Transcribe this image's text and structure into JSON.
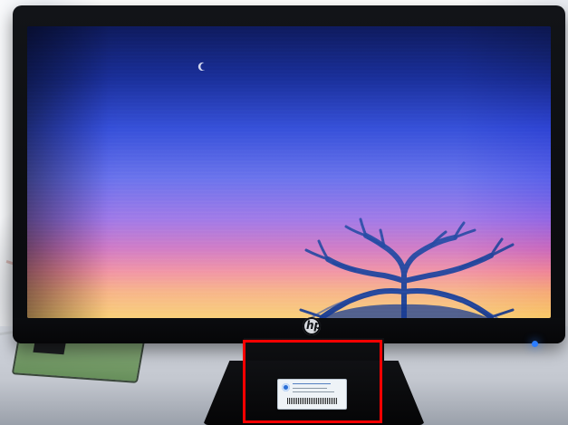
{
  "scene": {
    "type": "photo",
    "subject": "monitor",
    "brand_logo_text": "hp",
    "colors": {
      "screen_top": "#0e1a5c",
      "screen_mid": "#6a73ec",
      "screen_bottom": "#f9d07a",
      "bezel": "#0c0d10",
      "highlight": "#ff0000",
      "power_led": "#2b7cff"
    },
    "icons": {
      "moon": "moon-icon",
      "tree": "tree-icon",
      "brand": "hp-logo-icon",
      "power": "power-led-icon"
    }
  }
}
